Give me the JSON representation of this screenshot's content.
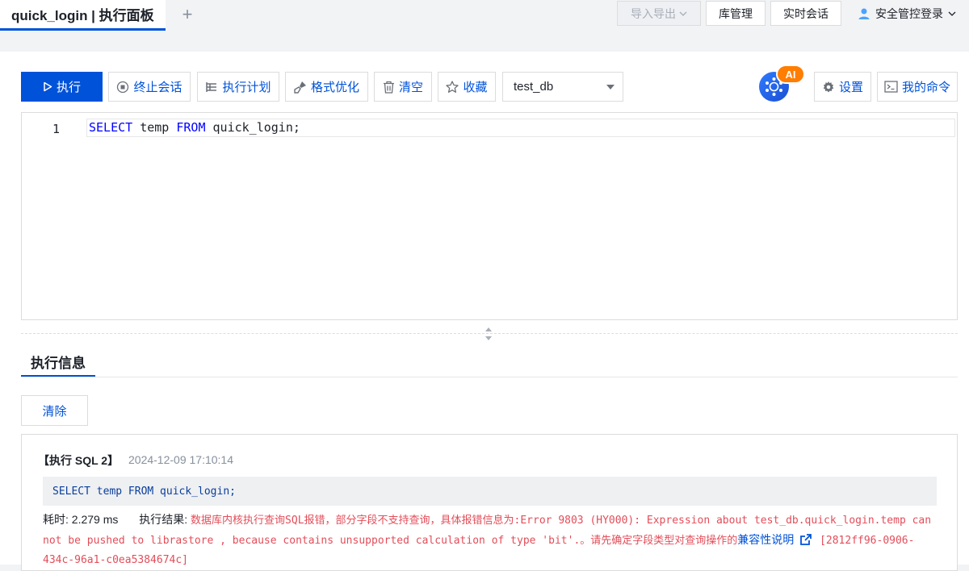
{
  "tabs": {
    "active_label": "quick_login | 执行面板",
    "add_label": "+"
  },
  "top_actions": {
    "import_export": "导入导出",
    "db_manage": "库管理",
    "realtime_session": "实时会话",
    "user_label": "安全管控登录"
  },
  "toolbar": {
    "execute": "执行",
    "stop_session": "终止会话",
    "exec_plan": "执行计划",
    "format": "格式优化",
    "clear": "清空",
    "favorite": "收藏",
    "db_selected": "test_db",
    "ai_badge": "AI",
    "settings": "设置",
    "my_commands": "我的命令"
  },
  "editor": {
    "line_number": "1",
    "code_kw1": "SELECT",
    "code_ident1": " temp ",
    "code_kw2": "FROM",
    "code_ident2": " quick_login;"
  },
  "exec_info": {
    "tab_label": "执行信息",
    "clear_button": "清除",
    "result": {
      "title": "【执行 SQL 2】",
      "time": "2024-12-09 17:10:14",
      "sql": "SELECT temp FROM quick_login;",
      "duration_label": "耗时:",
      "duration_value": "2.279 ms",
      "result_label": "执行结果:",
      "error_text": "数据库内核执行查询SQL报错，部分字段不支持查询，具体报错信息为:Error 9803 (HY000): Expression about test_db.quick_login.temp can not be pushed to librastore , because contains unsupported calculation of type 'bit'.。请先确定字段类型对查询操作的",
      "link_text": "兼容性说明",
      "request_id": "[2812ff96-0906-434c-96a1-c0ea5384674c]"
    }
  },
  "colors": {
    "primary": "#0052d9",
    "error": "#e34d59",
    "ai_badge": "#ff7d00"
  }
}
